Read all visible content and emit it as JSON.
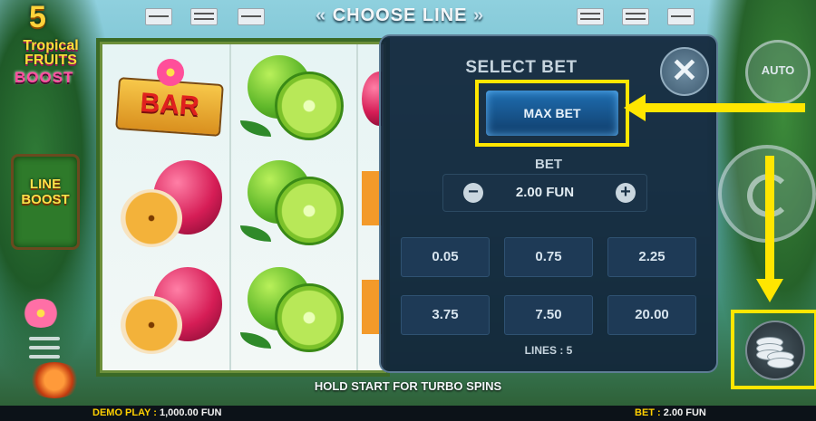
{
  "header": {
    "choose_line_label": "CHOOSE LINE",
    "left_chevrons": "«",
    "right_chevrons": "»"
  },
  "logo": {
    "number": "5",
    "line1": "Tropical",
    "line2": "FRUITS",
    "line3": "BOOST"
  },
  "line_boost": {
    "line1": "LINE",
    "line2": "BOOST"
  },
  "reels": {
    "bar_symbol": "BAR"
  },
  "select_bet": {
    "title": "SELECT BET",
    "close_glyph": "✕",
    "max_bet_label": "MAX BET",
    "bet_label": "BET",
    "minus_glyph": "−",
    "plus_glyph": "+",
    "bet_value": "2.00 FUN",
    "options": [
      "0.05",
      "0.75",
      "2.25",
      "3.75",
      "7.50",
      "20.00"
    ],
    "lines_label": "LINES : 5"
  },
  "controls": {
    "auto_label": "AUTO"
  },
  "footer": {
    "hint": "HOLD START FOR TURBO SPINS",
    "demo_label": "DEMO PLAY :",
    "demo_value": "1,000.00 FUN",
    "bet_label": "BET :",
    "bet_value": "2.00 FUN"
  },
  "colors": {
    "highlight": "#ffe600",
    "panel_bg": "#12263a",
    "max_bet_blue": "#1f6fb2"
  },
  "icons": [
    "line-indicator-icon",
    "close-icon",
    "minus-icon",
    "plus-icon",
    "autoplay-icon",
    "spin-icon",
    "coins-icon",
    "menu-icon",
    "arrow-icon"
  ]
}
